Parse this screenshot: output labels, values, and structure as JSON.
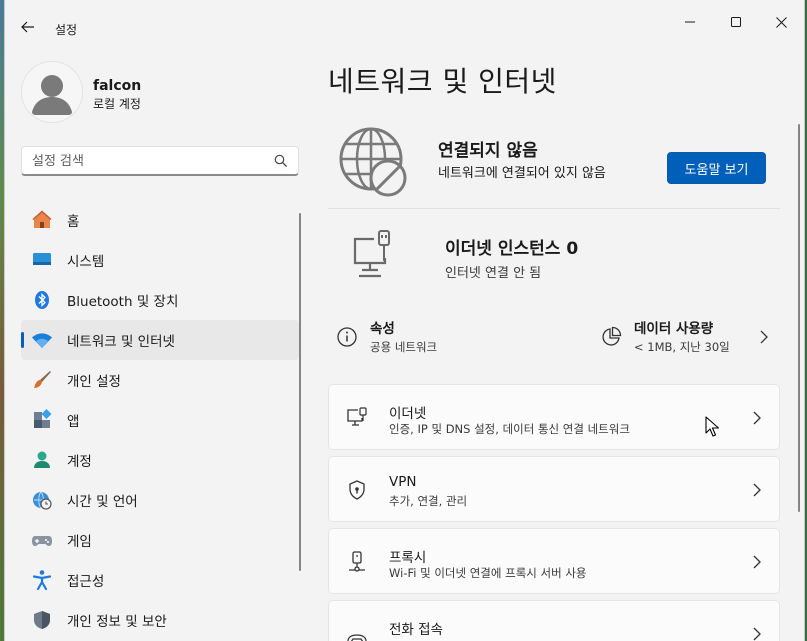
{
  "app": {
    "title": "설정"
  },
  "profile": {
    "name": "falcon",
    "account_type": "로컬 계정"
  },
  "search": {
    "placeholder": "설정 검색"
  },
  "sidebar": {
    "items": [
      {
        "label": "홈",
        "icon": "home-icon"
      },
      {
        "label": "시스템",
        "icon": "monitor-icon"
      },
      {
        "label": "Bluetooth 및 장치",
        "icon": "bluetooth-icon"
      },
      {
        "label": "네트워크 및 인터넷",
        "icon": "wifi-icon",
        "active": true
      },
      {
        "label": "개인 설정",
        "icon": "paintbrush-icon"
      },
      {
        "label": "앱",
        "icon": "apps-icon"
      },
      {
        "label": "계정",
        "icon": "person-icon"
      },
      {
        "label": "시간 및 언어",
        "icon": "globe-clock-icon"
      },
      {
        "label": "게임",
        "icon": "gamepad-icon"
      },
      {
        "label": "접근성",
        "icon": "accessibility-icon"
      },
      {
        "label": "개인 정보 및 보안",
        "icon": "shield-icon"
      }
    ]
  },
  "main": {
    "title": "네트워크 및 인터넷",
    "status": {
      "title": "연결되지 않음",
      "subtitle": "네트워크에 연결되어 있지 않음",
      "help_button": "도움말 보기"
    },
    "ethernet_instance": {
      "title": "이더넷 인스턴스 0",
      "subtitle": "인터넷 연결 안 됨"
    },
    "properties": {
      "title": "속성",
      "subtitle": "공용 네트워크"
    },
    "data_usage": {
      "title": "데이터 사용량",
      "subtitle": "< 1MB, 지난 30일"
    },
    "list": [
      {
        "title": "이더넷",
        "subtitle": "인증, IP 및 DNS 설정, 데이터 통신 연결 네트워크",
        "icon": "ethernet-icon"
      },
      {
        "title": "VPN",
        "subtitle": "추가, 연결, 관리",
        "icon": "vpn-shield-icon"
      },
      {
        "title": "프록시",
        "subtitle": "Wi-Fi 및 이더넷 연결에 프록시 서버 사용",
        "icon": "proxy-icon"
      },
      {
        "title": "전화 접속",
        "subtitle": "",
        "icon": "dialup-phone-icon"
      }
    ]
  },
  "colors": {
    "accent": "#005fb8",
    "window_bg": "#f3f3f3",
    "card_bg": "#fbfbfb"
  }
}
